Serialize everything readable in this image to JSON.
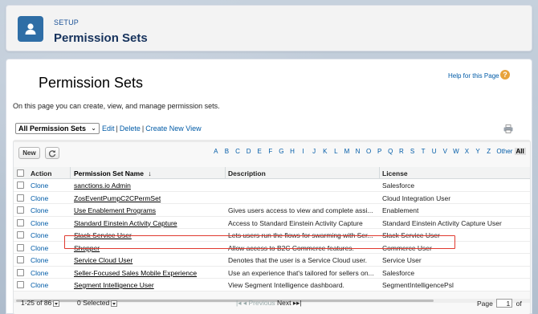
{
  "header": {
    "eyebrow": "SETUP",
    "title": "Permission Sets",
    "icon": "user-icon"
  },
  "page": {
    "title": "Permission Sets",
    "help_link": "Help for this Page",
    "intro": "On this page you can create, view, and manage permission sets."
  },
  "view": {
    "selected": "All Permission Sets",
    "edit": "Edit",
    "delete": "Delete",
    "create": "Create New View"
  },
  "toolbar": {
    "new_label": "New",
    "alphabet": [
      "A",
      "B",
      "C",
      "D",
      "E",
      "F",
      "G",
      "H",
      "I",
      "J",
      "K",
      "L",
      "M",
      "N",
      "O",
      "P",
      "Q",
      "R",
      "S",
      "T",
      "U",
      "V",
      "W",
      "X",
      "Y",
      "Z"
    ],
    "other": "Other",
    "all": "All"
  },
  "table": {
    "headers": {
      "action": "Action",
      "name": "Permission Set Name",
      "sort_indicator": "↓",
      "description": "Description",
      "license": "License"
    },
    "rows": [
      {
        "action": "Clone",
        "name": "sanctions.io Admin",
        "description": "",
        "license": "Salesforce"
      },
      {
        "action": "Clone",
        "name": "ZosEventPumpC2CPermSet",
        "description": "",
        "license": "Cloud Integration User"
      },
      {
        "action": "Clone",
        "name": "Use Enablement Programs",
        "description": "Gives users access to view and complete assi...",
        "license": "Enablement"
      },
      {
        "action": "Clone",
        "name": "Standard Einstein Activity Capture",
        "description": "Access to Standard Einstein Activity Capture",
        "license": "Standard Einstein Activity Capture User"
      },
      {
        "action": "Clone",
        "name": "Slack Service User",
        "description": "Lets users run the flows for swarming with Ser...",
        "license": "Slack Service User"
      },
      {
        "action": "Clone",
        "name": "Shopper",
        "description": "Allow access to B2C Commerce features.",
        "license": "Commerce User"
      },
      {
        "action": "Clone",
        "name": "Service Cloud User",
        "description": "Denotes that the user is a Service Cloud user.",
        "license": "Service User"
      },
      {
        "action": "Clone",
        "name": "Seller-Focused Sales Mobile Experience",
        "description": "Use an experience that's tailored for sellers on...",
        "license": "Salesforce"
      },
      {
        "action": "Clone",
        "name": "Segment Intelligence User",
        "description": "View Segment Intelligence dashboard.",
        "license": "SegmentIntelligencePsl"
      }
    ]
  },
  "footer": {
    "range": "1-25 of 86",
    "selected": "0 Selected",
    "previous": "Previous",
    "next": "Next",
    "page_label": "Page",
    "page_value": "1",
    "of": "of"
  },
  "colors": {
    "header_icon_bg": "#2f6ea6",
    "link": "#015ba7",
    "highlight": "#e03a2f",
    "help_icon": "#e8a33c"
  }
}
